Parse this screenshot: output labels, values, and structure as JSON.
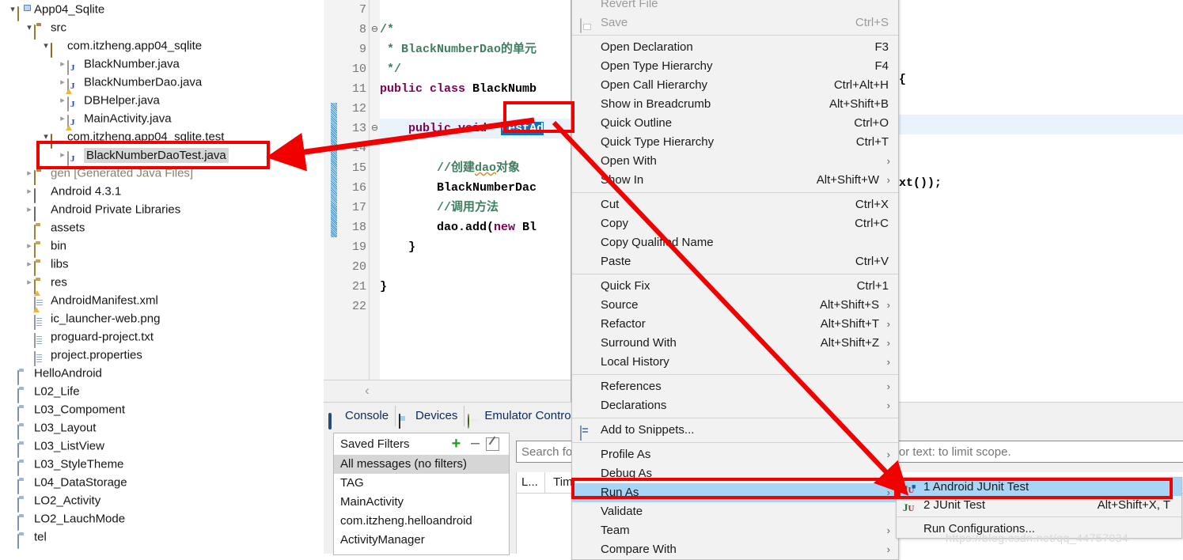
{
  "explorer": {
    "name": "package-explorer",
    "items": [
      {
        "label": "App04_Sqlite",
        "icon": "project-icon",
        "indent": 0,
        "arrow": "open",
        "state": "normal"
      },
      {
        "label": "src",
        "icon": "source-folder-icon",
        "indent": 1,
        "arrow": "open",
        "state": "normal"
      },
      {
        "label": "com.itzheng.app04_sqlite",
        "icon": "package-icon",
        "indent": 2,
        "arrow": "open",
        "state": "normal"
      },
      {
        "label": "BlackNumber.java",
        "icon": "java-file-icon",
        "indent": 3,
        "arrow": "closed",
        "state": "normal"
      },
      {
        "label": "BlackNumberDao.java",
        "icon": "java-file-warn-icon",
        "indent": 3,
        "arrow": "closed",
        "state": "normal"
      },
      {
        "label": "DBHelper.java",
        "icon": "java-file-icon",
        "indent": 3,
        "arrow": "closed",
        "state": "normal"
      },
      {
        "label": "MainActivity.java",
        "icon": "java-file-warn-icon",
        "indent": 3,
        "arrow": "closed",
        "state": "normal"
      },
      {
        "label": "com.itzheng.app04_sqlite.test",
        "icon": "package-icon",
        "indent": 2,
        "arrow": "open",
        "state": "normal"
      },
      {
        "label": "BlackNumberDaoTest.java",
        "icon": "java-file-icon",
        "indent": 3,
        "arrow": "closed",
        "state": "selected"
      },
      {
        "label": "gen [Generated Java Files]",
        "icon": "source-folder-icon",
        "indent": 1,
        "arrow": "closed",
        "state": "dim"
      },
      {
        "label": "Android 4.3.1",
        "icon": "library-icon",
        "indent": 1,
        "arrow": "closed",
        "state": "normal"
      },
      {
        "label": "Android Private Libraries",
        "icon": "library-icon",
        "indent": 1,
        "arrow": "closed",
        "state": "normal"
      },
      {
        "label": "assets",
        "icon": "folder-icon",
        "indent": 1,
        "arrow": "none",
        "state": "normal"
      },
      {
        "label": "bin",
        "icon": "folder-icon",
        "indent": 1,
        "arrow": "closed",
        "state": "normal"
      },
      {
        "label": "libs",
        "icon": "folder-icon",
        "indent": 1,
        "arrow": "closed",
        "state": "normal"
      },
      {
        "label": "res",
        "icon": "folder-warn-icon",
        "indent": 1,
        "arrow": "closed",
        "state": "normal"
      },
      {
        "label": "AndroidManifest.xml",
        "icon": "xml-file-icon",
        "indent": 1,
        "arrow": "none",
        "state": "normal"
      },
      {
        "label": "ic_launcher-web.png",
        "icon": "file-icon",
        "indent": 1,
        "arrow": "none",
        "state": "normal"
      },
      {
        "label": "proguard-project.txt",
        "icon": "file-icon",
        "indent": 1,
        "arrow": "none",
        "state": "normal"
      },
      {
        "label": "project.properties",
        "icon": "file-icon",
        "indent": 1,
        "arrow": "none",
        "state": "normal"
      },
      {
        "label": "HelloAndroid",
        "icon": "closed-project-icon",
        "indent": 0,
        "arrow": "none",
        "state": "normal"
      },
      {
        "label": "L02_Life",
        "icon": "closed-project-icon",
        "indent": 0,
        "arrow": "none",
        "state": "normal"
      },
      {
        "label": "L03_Compoment",
        "icon": "closed-project-icon",
        "indent": 0,
        "arrow": "none",
        "state": "normal"
      },
      {
        "label": "L03_Layout",
        "icon": "closed-project-icon",
        "indent": 0,
        "arrow": "none",
        "state": "normal"
      },
      {
        "label": "L03_ListView",
        "icon": "closed-project-icon",
        "indent": 0,
        "arrow": "none",
        "state": "normal"
      },
      {
        "label": "L03_StyleTheme",
        "icon": "closed-project-icon",
        "indent": 0,
        "arrow": "none",
        "state": "normal"
      },
      {
        "label": "L04_DataStorage",
        "icon": "closed-project-icon",
        "indent": 0,
        "arrow": "none",
        "state": "normal"
      },
      {
        "label": "LO2_Activity",
        "icon": "closed-project-icon",
        "indent": 0,
        "arrow": "none",
        "state": "normal"
      },
      {
        "label": "LO2_LauchMode",
        "icon": "closed-project-icon",
        "indent": 0,
        "arrow": "none",
        "state": "normal"
      },
      {
        "label": "tel",
        "icon": "closed-project-icon",
        "indent": 0,
        "arrow": "none",
        "state": "normal"
      }
    ]
  },
  "editor": {
    "lines": [
      {
        "num": "7",
        "fold": "",
        "text": "",
        "hl": false
      },
      {
        "num": "8",
        "fold": "⊖",
        "text": "/*",
        "hl": false
      },
      {
        "num": "9",
        "fold": "",
        "text": " * BlackNumberDao的单元",
        "hl": false
      },
      {
        "num": "10",
        "fold": "",
        "text": " */",
        "hl": false
      },
      {
        "num": "11",
        "fold": "",
        "text": "public class BlackNumb",
        "hl": false
      },
      {
        "num": "12",
        "fold": "",
        "text": "",
        "hl": false
      },
      {
        "num": "13",
        "fold": "⊖",
        "text": "    public void  testAd",
        "hl": true
      },
      {
        "num": "14",
        "fold": "",
        "text": "",
        "hl": false
      },
      {
        "num": "15",
        "fold": "",
        "text": "        //创建dao对象",
        "hl": false
      },
      {
        "num": "16",
        "fold": "",
        "text": "        BlackNumberDac",
        "hl": false
      },
      {
        "num": "17",
        "fold": "",
        "text": "        //调用方法",
        "hl": false
      },
      {
        "num": "18",
        "fold": "",
        "text": "        dao.add(new Bl",
        "hl": false
      },
      {
        "num": "19",
        "fold": "",
        "text": "    }",
        "hl": false
      },
      {
        "num": "20",
        "fold": "",
        "text": "",
        "hl": false
      },
      {
        "num": "21",
        "fold": "",
        "text": "}",
        "hl": false
      },
      {
        "num": "22",
        "fold": "",
        "text": "",
        "hl": false
      }
    ],
    "selected_token": "testAd",
    "right_fragment_brace": "{",
    "right_fragment_call": "xt());"
  },
  "context_menu": {
    "items": [
      {
        "label": "Revert File",
        "accel": "",
        "submenu": false,
        "icon": "",
        "disabled": true,
        "highlight": false
      },
      {
        "label": "Save",
        "accel": "Ctrl+S",
        "submenu": false,
        "icon": "save-icon",
        "disabled": true,
        "highlight": false
      },
      {
        "separator": true
      },
      {
        "label": "Open Declaration",
        "accel": "F3",
        "submenu": false,
        "icon": "",
        "disabled": false,
        "highlight": false
      },
      {
        "label": "Open Type Hierarchy",
        "accel": "F4",
        "submenu": false,
        "icon": "",
        "disabled": false,
        "highlight": false
      },
      {
        "label": "Open Call Hierarchy",
        "accel": "Ctrl+Alt+H",
        "submenu": false,
        "icon": "",
        "disabled": false,
        "highlight": false
      },
      {
        "label": "Show in Breadcrumb",
        "accel": "Alt+Shift+B",
        "submenu": false,
        "icon": "",
        "disabled": false,
        "highlight": false
      },
      {
        "label": "Quick Outline",
        "accel": "Ctrl+O",
        "submenu": false,
        "icon": "",
        "disabled": false,
        "highlight": false
      },
      {
        "label": "Quick Type Hierarchy",
        "accel": "Ctrl+T",
        "submenu": false,
        "icon": "",
        "disabled": false,
        "highlight": false
      },
      {
        "label": "Open With",
        "accel": "",
        "submenu": true,
        "icon": "",
        "disabled": false,
        "highlight": false
      },
      {
        "label": "Show In",
        "accel": "Alt+Shift+W",
        "submenu": true,
        "icon": "",
        "disabled": false,
        "highlight": false
      },
      {
        "separator": true
      },
      {
        "label": "Cut",
        "accel": "Ctrl+X",
        "submenu": false,
        "icon": "",
        "disabled": false,
        "highlight": false
      },
      {
        "label": "Copy",
        "accel": "Ctrl+C",
        "submenu": false,
        "icon": "",
        "disabled": false,
        "highlight": false
      },
      {
        "label": "Copy Qualified Name",
        "accel": "",
        "submenu": false,
        "icon": "",
        "disabled": false,
        "highlight": false
      },
      {
        "label": "Paste",
        "accel": "Ctrl+V",
        "submenu": false,
        "icon": "",
        "disabled": false,
        "highlight": false
      },
      {
        "separator": true
      },
      {
        "label": "Quick Fix",
        "accel": "Ctrl+1",
        "submenu": false,
        "icon": "",
        "disabled": false,
        "highlight": false
      },
      {
        "label": "Source",
        "accel": "Alt+Shift+S",
        "submenu": true,
        "icon": "",
        "disabled": false,
        "highlight": false
      },
      {
        "label": "Refactor",
        "accel": "Alt+Shift+T",
        "submenu": true,
        "icon": "",
        "disabled": false,
        "highlight": false
      },
      {
        "label": "Surround With",
        "accel": "Alt+Shift+Z",
        "submenu": true,
        "icon": "",
        "disabled": false,
        "highlight": false
      },
      {
        "label": "Local History",
        "accel": "",
        "submenu": true,
        "icon": "",
        "disabled": false,
        "highlight": false
      },
      {
        "separator": true
      },
      {
        "label": "References",
        "accel": "",
        "submenu": true,
        "icon": "",
        "disabled": false,
        "highlight": false
      },
      {
        "label": "Declarations",
        "accel": "",
        "submenu": true,
        "icon": "",
        "disabled": false,
        "highlight": false
      },
      {
        "separator": true
      },
      {
        "label": "Add to Snippets...",
        "accel": "",
        "submenu": false,
        "icon": "snippets-icon",
        "disabled": false,
        "highlight": false
      },
      {
        "separator": true
      },
      {
        "label": "Profile As",
        "accel": "",
        "submenu": true,
        "icon": "",
        "disabled": false,
        "highlight": false
      },
      {
        "label": "Debug As",
        "accel": "",
        "submenu": true,
        "icon": "",
        "disabled": false,
        "highlight": false
      },
      {
        "label": "Run As",
        "accel": "",
        "submenu": true,
        "icon": "",
        "disabled": false,
        "highlight": true
      },
      {
        "label": "Validate",
        "accel": "",
        "submenu": false,
        "icon": "",
        "disabled": false,
        "highlight": false
      },
      {
        "label": "Team",
        "accel": "",
        "submenu": true,
        "icon": "",
        "disabled": false,
        "highlight": false
      },
      {
        "label": "Compare With",
        "accel": "",
        "submenu": true,
        "icon": "",
        "disabled": false,
        "highlight": false
      }
    ]
  },
  "run_as_submenu": {
    "items": [
      {
        "label": "1 Android JUnit Test",
        "accel": "",
        "icon": "android-junit-icon",
        "highlight": true
      },
      {
        "label": "2 JUnit Test",
        "accel": "Alt+Shift+X, T",
        "icon": "junit-icon",
        "highlight": false
      },
      {
        "separator": true
      },
      {
        "label": "Run Configurations...",
        "accel": "",
        "icon": "",
        "highlight": false
      }
    ]
  },
  "bottom_panel": {
    "tabs": [
      {
        "label": "Console",
        "icon": "console-icon",
        "active": false
      },
      {
        "label": "Devices",
        "icon": "device-icon",
        "active": false
      },
      {
        "label": "Emulator Contro",
        "icon": "emulator-icon",
        "active": true
      }
    ],
    "saved_filters": {
      "title": "Saved Filters",
      "add_label": "+",
      "remove_label": "–",
      "edit_label": "edit-filter-icon",
      "entries": [
        {
          "label": "All messages (no filters)",
          "active": true
        },
        {
          "label": "TAG",
          "active": false
        },
        {
          "label": "MainActivity",
          "active": false
        },
        {
          "label": "com.itzheng.helloandroid",
          "active": false
        },
        {
          "label": "ActivityManager",
          "active": false
        }
      ]
    },
    "search": {
      "placeholder": "Search for messages. Accepts Java regexes. Prefix with pid:, app:, tag: or text: to limit scope.",
      "value": ""
    },
    "log_columns": [
      {
        "label": "L...",
        "width": 36
      },
      {
        "label": "Time",
        "width": 72
      }
    ]
  },
  "watermark": "https://blog.csdn.net/qq_44757034",
  "colors": {
    "annotation_red": "#f10000",
    "menu_highlight": "#a8d4f5",
    "selection_blue": "#0a72c4",
    "current_line": "#e9f1fb"
  }
}
